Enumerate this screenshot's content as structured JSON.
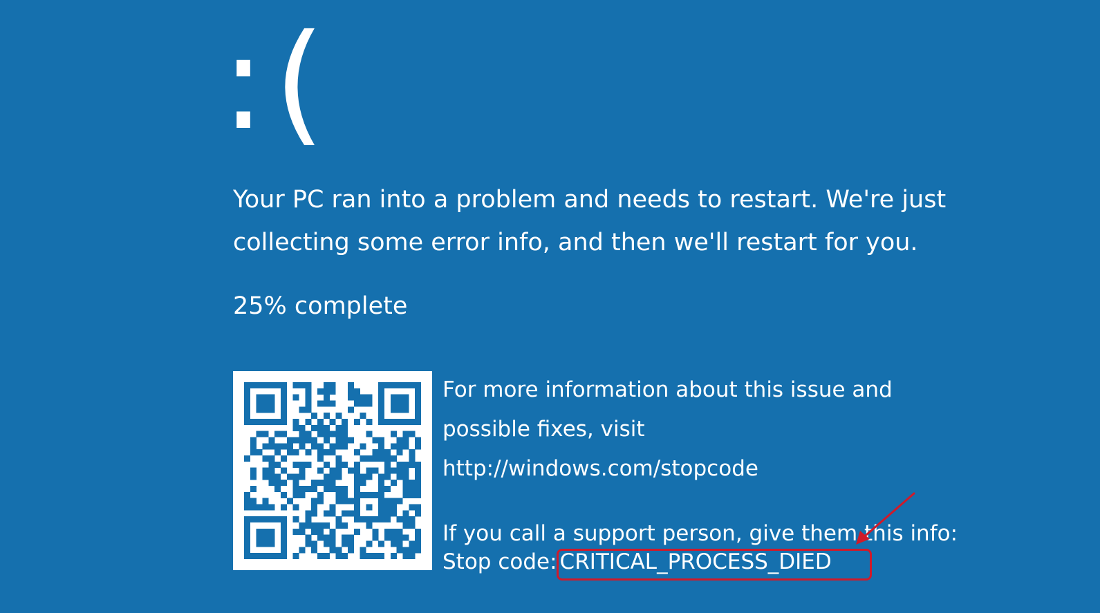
{
  "screen": {
    "background_color": "#1570ae",
    "text_color": "#ffffff",
    "sad_face": ":(",
    "message_line1": "Your PC ran into a problem and needs to restart. We're just",
    "message_line2": "collecting some error info, and then we'll restart for you.",
    "progress_text": "25% complete",
    "progress_percent": 25,
    "qr_code_icon": "qr-code",
    "info_line1": "For more information about this issue and",
    "info_line2": "possible fixes, visit",
    "info_url": "http://windows.com/stopcode",
    "support_line": "If you call a support person, give them this info:",
    "stop_code_label": "Stop code:",
    "stop_code_value": "CRITICAL_PROCESS_DIED"
  },
  "annotations": {
    "highlight_color": "#d01a2a",
    "highlight_icon": "highlight-rectangle",
    "arrow_icon": "pointer-arrow"
  }
}
